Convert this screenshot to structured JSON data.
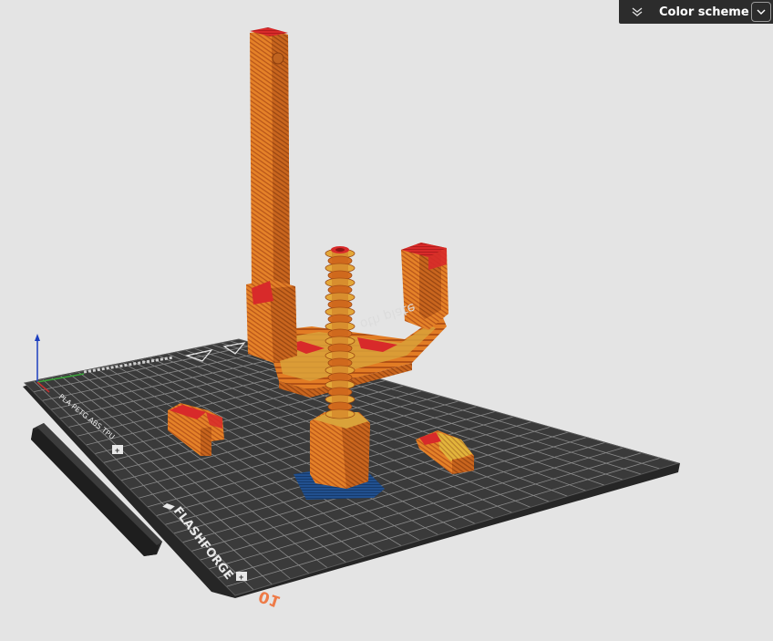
{
  "toolbar": {
    "color_scheme_label": "Color scheme",
    "collapse_icon": "double-chevron-down-icon",
    "dropdown_icon": "chevron-down-icon"
  },
  "plate": {
    "brand_label": "FLASHFORGE",
    "filament_label": "PLA PETG ABS TPU",
    "plate_number": "01"
  },
  "colors": {
    "background": "#e4e4e4",
    "plate": "#3a3a3a",
    "model_orange": "#e07a22",
    "top_surface": "#d8262b",
    "infill_yellow": "#e3b53b",
    "support_blue": "#1f4a88",
    "plate_number": "#ee7b48"
  }
}
